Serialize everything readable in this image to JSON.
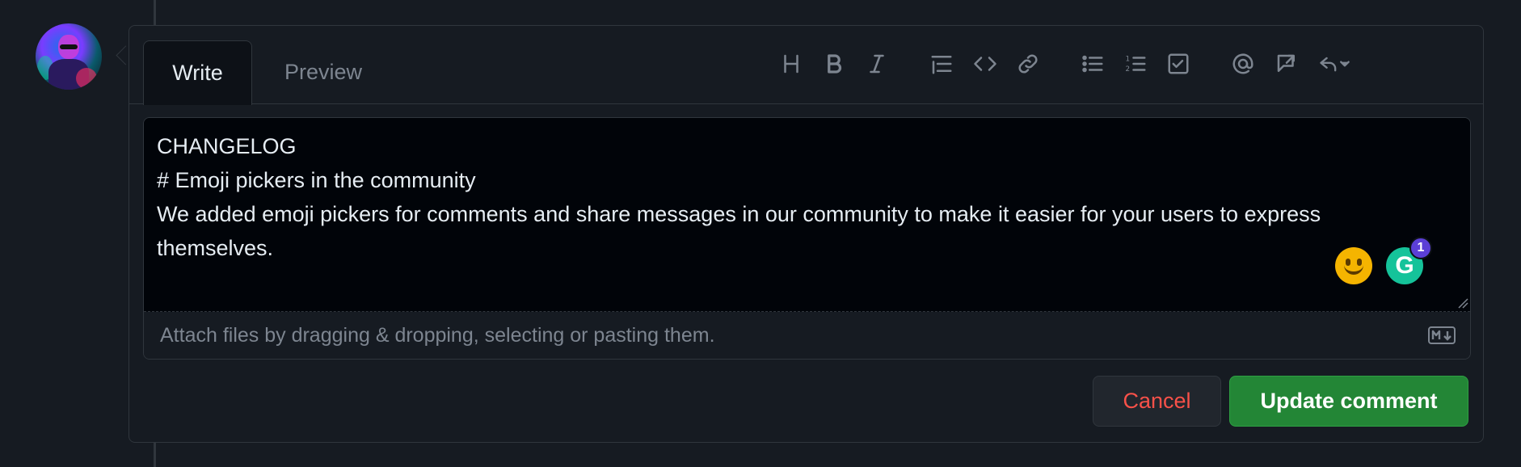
{
  "avatar": {
    "alt": "user avatar"
  },
  "tabs": [
    {
      "label": "Write",
      "active": true
    },
    {
      "label": "Preview",
      "active": false
    }
  ],
  "toolbar": {
    "icons": [
      "heading-icon",
      "bold-icon",
      "italic-icon",
      "quote-icon",
      "code-icon",
      "link-icon",
      "unordered-list-icon",
      "ordered-list-icon",
      "task-list-icon",
      "mention-icon",
      "reference-icon",
      "reply-icon"
    ]
  },
  "editor": {
    "lines": [
      "CHANGELOG",
      "# Emoji pickers in the community",
      "We added emoji pickers for comments and share messages in our community to make it easier for your users to express themselves."
    ],
    "attach_text": "Attach files by dragging & dropping, selecting or pasting them.",
    "grammarly_letter": "G",
    "grammarly_count": "1"
  },
  "actions": {
    "cancel_label": "Cancel",
    "update_label": "Update comment"
  },
  "colors": {
    "background": "#161b22",
    "editor_bg": "#010409",
    "cancel_text": "#f85149",
    "update_bg": "#238636"
  }
}
